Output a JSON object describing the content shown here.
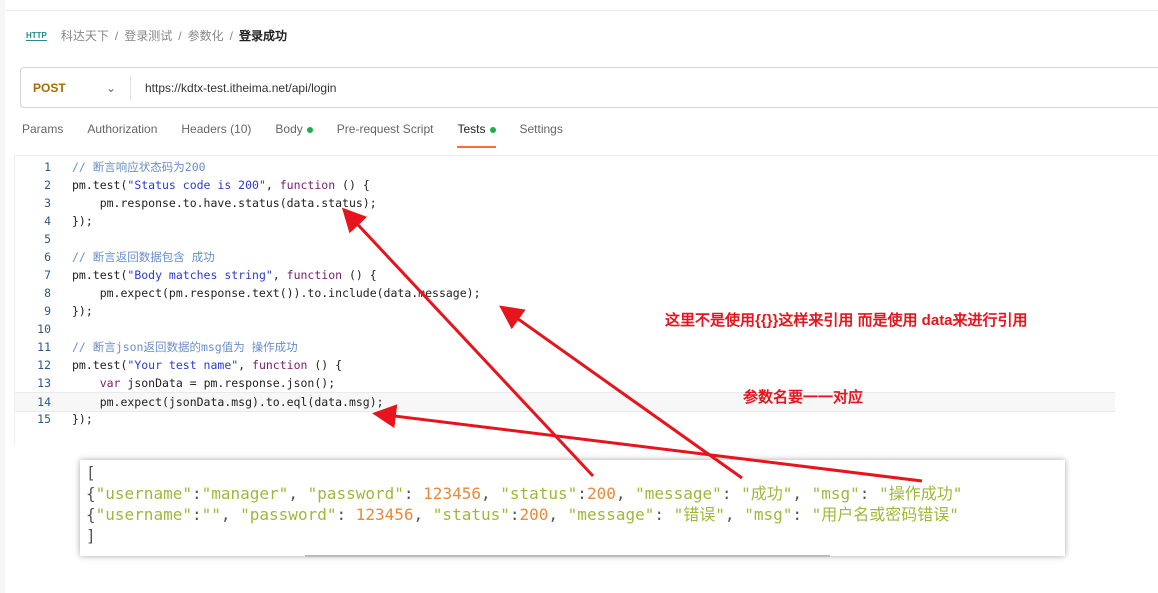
{
  "breadcrumb": {
    "icon": "http-icon",
    "icon_text": "HTTP",
    "items": [
      "科达天下",
      "登录测试",
      "参数化"
    ],
    "current": "登录成功",
    "separator": "/"
  },
  "request": {
    "method": "POST",
    "url": "https://kdtx-test.itheima.net/api/login"
  },
  "tabs": [
    {
      "label": "Params"
    },
    {
      "label": "Authorization"
    },
    {
      "label": "Headers (10)"
    },
    {
      "label": "Body",
      "dot": true
    },
    {
      "label": "Pre-request Script"
    },
    {
      "label": "Tests",
      "dot": true,
      "active": true
    },
    {
      "label": "Settings"
    }
  ],
  "colors": {
    "accent": "#ff6c37",
    "dot": "#1fae4f",
    "annotation": "#e6141c"
  },
  "code": [
    [
      [
        "// 断言响应状态码为200",
        "cm"
      ]
    ],
    [
      [
        "pm.test(",
        "tx"
      ],
      [
        "\"Status code is 200\"",
        "str"
      ],
      [
        ", ",
        "tx"
      ],
      [
        "function",
        "kw"
      ],
      [
        " () {",
        "tx"
      ]
    ],
    [
      [
        "    pm.response.to.have.status(data.status);",
        "tx"
      ]
    ],
    [
      [
        "});",
        "tx"
      ]
    ],
    [],
    [
      [
        "// 断言返回数据包含 成功",
        "cm"
      ]
    ],
    [
      [
        "pm.test(",
        "tx"
      ],
      [
        "\"Body matches string\"",
        "str"
      ],
      [
        ", ",
        "tx"
      ],
      [
        "function",
        "kw"
      ],
      [
        " () {",
        "tx"
      ]
    ],
    [
      [
        "    pm.expect(pm.response.text()).to.include(data.message);",
        "tx"
      ]
    ],
    [
      [
        "});",
        "tx"
      ]
    ],
    [],
    [
      [
        "// 断言json返回数据的msg值为 操作成功",
        "cm"
      ]
    ],
    [
      [
        "pm.test(",
        "tx"
      ],
      [
        "\"Your test name\"",
        "str"
      ],
      [
        ", ",
        "tx"
      ],
      [
        "function",
        "kw"
      ],
      [
        " () {",
        "tx"
      ]
    ],
    [
      [
        "    ",
        "tx"
      ],
      [
        "var",
        "var"
      ],
      [
        " jsonData = pm.response.json();",
        "tx"
      ]
    ],
    [
      [
        "    pm.expect(jsonData.msg).to.eql(data.msg);",
        "tx"
      ]
    ],
    [
      [
        "});",
        "tx"
      ]
    ]
  ],
  "annotations": {
    "note1": "这里不是使用{{}}这样来引用 而是使用 data来进行引用",
    "note2": "参数名要一一对应"
  },
  "json_panel": [
    [
      [
        "[",
        "p"
      ]
    ],
    [
      [
        "{",
        "p"
      ],
      [
        "\"username\"",
        "s"
      ],
      [
        ":",
        "p"
      ],
      [
        "\"manager\"",
        "s"
      ],
      [
        ", ",
        "p"
      ],
      [
        "\"password\"",
        "s"
      ],
      [
        ": ",
        "p"
      ],
      [
        "123456",
        "n"
      ],
      [
        ", ",
        "p"
      ],
      [
        "\"status\"",
        "s"
      ],
      [
        ":",
        "p"
      ],
      [
        "200",
        "n"
      ],
      [
        ", ",
        "p"
      ],
      [
        "\"message\"",
        "s"
      ],
      [
        ": ",
        "p"
      ],
      [
        "\"成功\"",
        "s"
      ],
      [
        ", ",
        "p"
      ],
      [
        "\"msg\"",
        "s"
      ],
      [
        ": ",
        "p"
      ],
      [
        "\"操作成功\"",
        "s"
      ]
    ],
    [
      [
        "{",
        "p"
      ],
      [
        "\"username\"",
        "s"
      ],
      [
        ":",
        "p"
      ],
      [
        "\"\"",
        "s"
      ],
      [
        ", ",
        "p"
      ],
      [
        "\"password\"",
        "s"
      ],
      [
        ": ",
        "p"
      ],
      [
        "123456",
        "n"
      ],
      [
        ", ",
        "p"
      ],
      [
        "\"status\"",
        "s"
      ],
      [
        ":",
        "p"
      ],
      [
        "200",
        "n"
      ],
      [
        ", ",
        "p"
      ],
      [
        "\"message\"",
        "s"
      ],
      [
        ": ",
        "p"
      ],
      [
        "\"错误\"",
        "s"
      ],
      [
        ", ",
        "p"
      ],
      [
        "\"msg\"",
        "s"
      ],
      [
        ": ",
        "p"
      ],
      [
        "\"用户名或密码错误\"",
        "s"
      ]
    ],
    [
      [
        "]",
        "p"
      ]
    ]
  ]
}
